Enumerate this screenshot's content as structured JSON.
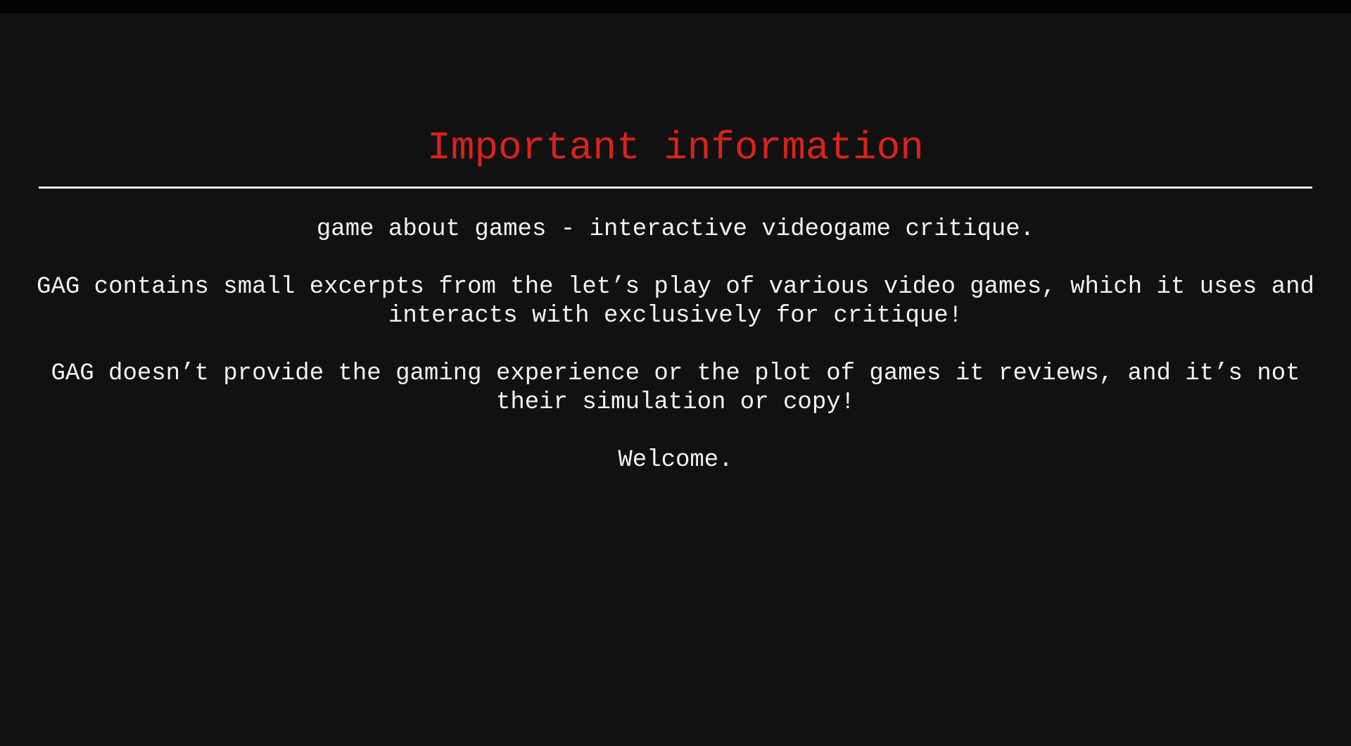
{
  "screen": {
    "title": "Important information",
    "title_color": "#d8231c",
    "paragraphs": [
      {
        "lines": [
          "game about games - interactive videogame critique."
        ]
      },
      {
        "lines": [
          "GAG contains small excerpts from the let’s play of various video games, which",
          "it uses and interacts with exclusively for critique!"
        ]
      },
      {
        "lines": [
          "GAG doesn’t provide the gaming experience or the plot of games it reviews, and",
          "it’s not their simulation or copy!"
        ]
      },
      {
        "lines": [
          "Welcome."
        ]
      }
    ]
  }
}
